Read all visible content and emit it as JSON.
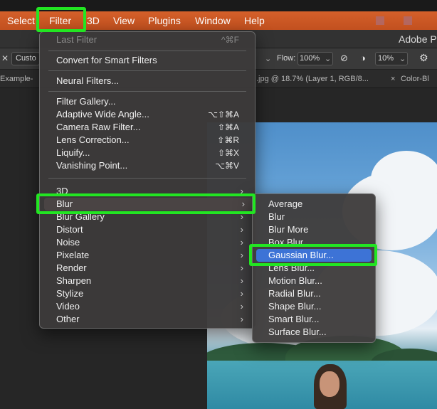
{
  "menubar": {
    "items": [
      "Select",
      "Filter",
      "3D",
      "View",
      "Plugins",
      "Window",
      "Help"
    ]
  },
  "titlebar": {
    "app_title": "Adobe Pl"
  },
  "options_bar": {
    "preset": "Custo",
    "flow_label": "Flow:",
    "flow_value": "100%",
    "smoothing_value": "10%"
  },
  "tabs": {
    "tab1": "Example-",
    "tab2": ".jpg @ 18.7% (Layer 1, RGB/8...",
    "tab3_close": "×",
    "tab3": "Color-Bl"
  },
  "filter_menu": {
    "last_filter": {
      "label": "Last Filter",
      "shortcut": "^⌘F"
    },
    "convert_smart": "Convert for Smart Filters",
    "neural": "Neural Filters...",
    "gallery_group": [
      {
        "label": "Filter Gallery...",
        "shortcut": ""
      },
      {
        "label": "Adaptive Wide Angle...",
        "shortcut": "⌥⇧⌘A"
      },
      {
        "label": "Camera Raw Filter...",
        "shortcut": "⇧⌘A"
      },
      {
        "label": "Lens Correction...",
        "shortcut": "⇧⌘R"
      },
      {
        "label": "Liquify...",
        "shortcut": "⇧⌘X"
      },
      {
        "label": "Vanishing Point...",
        "shortcut": "⌥⌘V"
      }
    ],
    "submenus": [
      "3D",
      "Blur",
      "Blur Gallery",
      "Distort",
      "Noise",
      "Pixelate",
      "Render",
      "Sharpen",
      "Stylize",
      "Video",
      "Other"
    ],
    "arrow": "›"
  },
  "blur_submenu": {
    "items": [
      "Average",
      "Blur",
      "Blur More",
      "Box Blur...",
      "Gaussian Blur...",
      "Lens Blur...",
      "Motion Blur...",
      "Radial Blur...",
      "Shape Blur...",
      "Smart Blur...",
      "Surface Blur..."
    ],
    "selected": "Gaussian Blur..."
  },
  "colors": {
    "menubar": "#c95525",
    "highlight_annotation": "#22e622",
    "selected_item": "#3d73d6"
  }
}
